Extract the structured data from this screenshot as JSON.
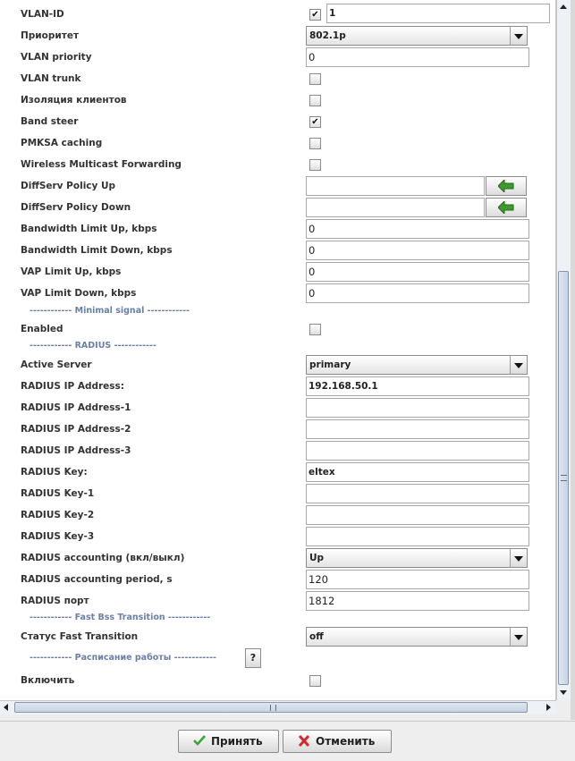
{
  "form": {
    "vlan_id": {
      "label": "VLAN-ID",
      "value": "1",
      "checked": "✔"
    },
    "priority": {
      "label": "Приоритет",
      "value": "802.1p"
    },
    "vlan_priority": {
      "label": "VLAN priority",
      "value": "0"
    },
    "vlan_trunk": {
      "label": "VLAN trunk"
    },
    "client_isolation": {
      "label": "Изоляция клиентов"
    },
    "band_steer": {
      "label": "Band steer",
      "checked": "✔"
    },
    "pmksa_caching": {
      "label": "PMKSA caching"
    },
    "wmf": {
      "label": "Wireless Multicast Forwarding"
    },
    "diffserv_up": {
      "label": "DiffServ Policy Up",
      "value": ""
    },
    "diffserv_down": {
      "label": "DiffServ Policy Down",
      "value": ""
    },
    "bw_up": {
      "label": "Bandwidth Limit Up, kbps",
      "value": "0"
    },
    "bw_down": {
      "label": "Bandwidth Limit Down, kbps",
      "value": "0"
    },
    "vap_up": {
      "label": "VAP Limit Up, kbps",
      "value": "0"
    },
    "vap_down": {
      "label": "VAP Limit Down, kbps",
      "value": "0"
    },
    "section_minimal_signal": "------------ Minimal signal ------------",
    "enabled": {
      "label": "Enabled"
    },
    "section_radius": "------------ RADIUS ------------",
    "active_server": {
      "label": "Active Server",
      "value": "primary"
    },
    "radius_ip": {
      "label": "RADIUS IP Address:",
      "value": "192.168.50.1"
    },
    "radius_ip_1": {
      "label": "RADIUS IP Address-1",
      "value": ""
    },
    "radius_ip_2": {
      "label": "RADIUS IP Address-2",
      "value": ""
    },
    "radius_ip_3": {
      "label": "RADIUS IP Address-3",
      "value": ""
    },
    "radius_key": {
      "label": "RADIUS Key:",
      "value": "eltex"
    },
    "radius_key_1": {
      "label": "RADIUS Key-1",
      "value": ""
    },
    "radius_key_2": {
      "label": "RADIUS Key-2",
      "value": ""
    },
    "radius_key_3": {
      "label": "RADIUS Key-3",
      "value": ""
    },
    "radius_accounting": {
      "label": "RADIUS accounting (вкл/выкл)",
      "value": "Up"
    },
    "radius_acc_period": {
      "label": "RADIUS accounting period, s",
      "value": "120"
    },
    "radius_port": {
      "label": "RADIUS порт",
      "value": "1812"
    },
    "section_fast_bss": "------------ Fast Bss Transition ------------",
    "ft_status": {
      "label": "Статус Fast Transition",
      "value": "off"
    },
    "section_schedule": "------------ Расписание работы ------------",
    "help_label": "?",
    "schedule_enable": {
      "label": "Включить"
    }
  },
  "footer": {
    "accept_label": "Принять",
    "cancel_label": "Отменить"
  },
  "colors": {
    "section_text": "#6a7fa5",
    "accept_icon": "#3aa53a",
    "cancel_icon": "#d42a2a",
    "arrow_icon": "#3e9a2c"
  },
  "icons": {
    "accept": "checkmark-icon",
    "cancel": "red-x-icon",
    "apply_arrow": "green-left-arrow-icon",
    "dropdown": "chevron-down-icon"
  }
}
